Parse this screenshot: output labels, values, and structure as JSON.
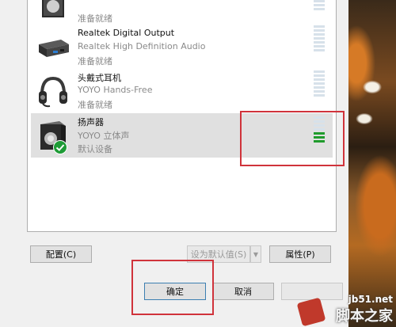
{
  "devices": [
    {
      "name": "",
      "desc": "",
      "status": "准备就绪",
      "selected": false,
      "meter_level": 0
    },
    {
      "name": "Realtek Digital Output",
      "desc": "Realtek High Definition Audio",
      "status": "准备就绪",
      "selected": false,
      "meter_level": 0
    },
    {
      "name": "头戴式耳机",
      "desc": "YOYO Hands-Free",
      "status": "准备就绪",
      "selected": false,
      "meter_level": 0
    },
    {
      "name": "扬声器",
      "desc": "YOYO 立体声",
      "status": "默认设备",
      "selected": true,
      "meter_level": 0.3
    }
  ],
  "buttons": {
    "configure": "配置(C)",
    "set_default": "设为默认值(S)",
    "properties": "属性(P)",
    "ok": "确定",
    "cancel": "取消"
  },
  "watermark": {
    "site": "jb51.net",
    "name": "脚本之家"
  },
  "colors": {
    "highlight": "#d0333b",
    "meter_on": "#1f9b2c",
    "selected_row": "#e0e0e0"
  }
}
